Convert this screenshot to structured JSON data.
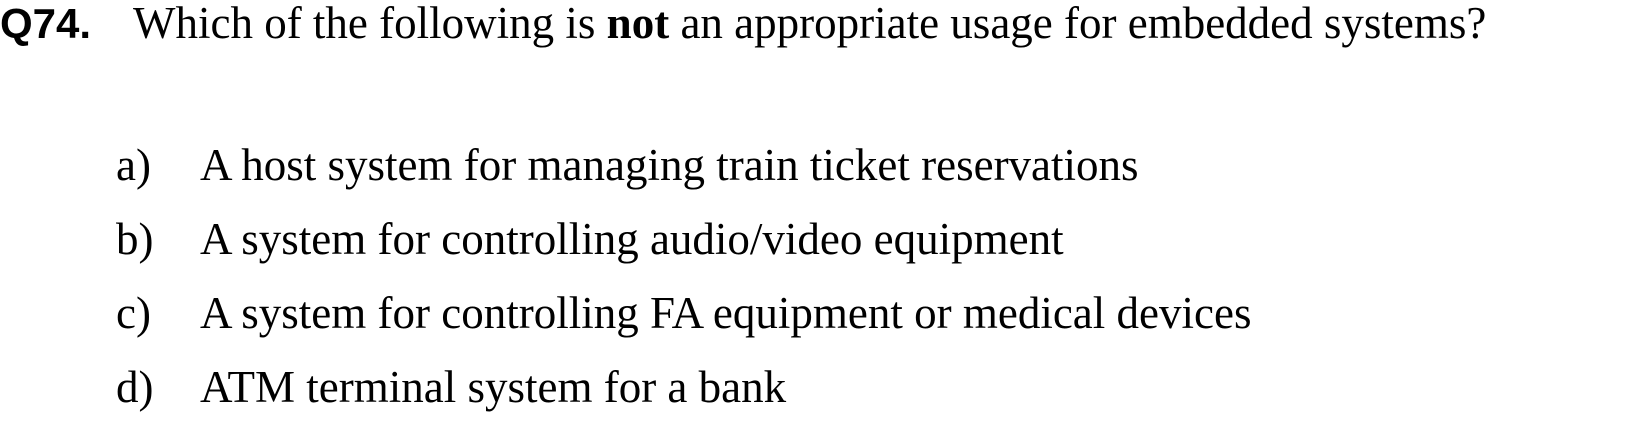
{
  "question": {
    "number": "Q74.",
    "text_before": "Which of the following is ",
    "text_bold": "not",
    "text_after": " an appropriate usage for embedded systems?"
  },
  "options": [
    {
      "letter": "a)",
      "text": "A host system for managing train ticket reservations"
    },
    {
      "letter": "b)",
      "text": "A system for controlling audio/video equipment"
    },
    {
      "letter": "c)",
      "text": "A system for controlling FA equipment or medical devices"
    },
    {
      "letter": "d)",
      "text": "ATM terminal system for a bank"
    }
  ]
}
